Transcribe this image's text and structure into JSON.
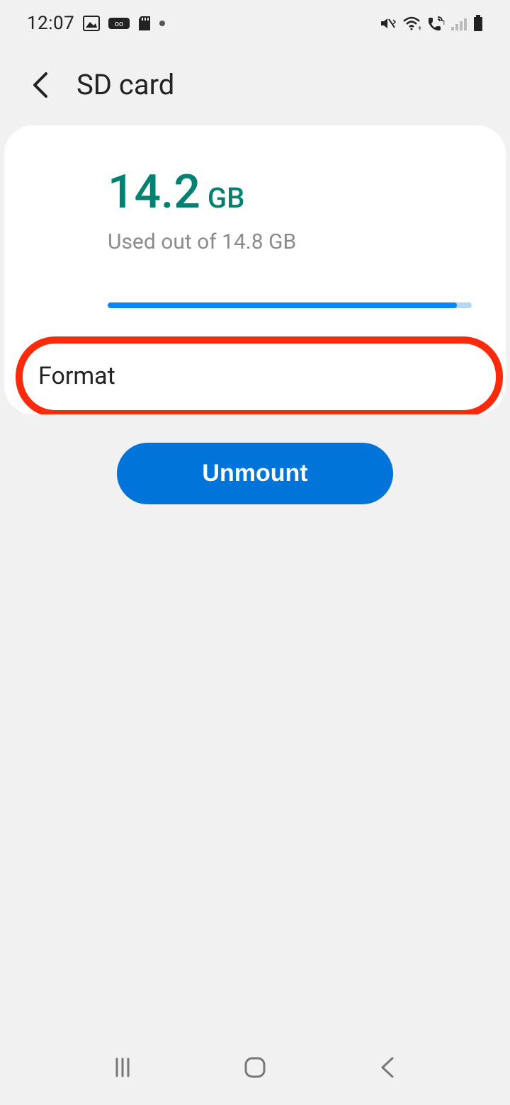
{
  "status_bar": {
    "time": "12:07"
  },
  "header": {
    "title": "SD card"
  },
  "storage": {
    "used_value": "14.2",
    "used_unit": "GB",
    "used_label": "Used out of 14.8 GB",
    "percent_fill": 95.9
  },
  "actions": {
    "format_label": "Format",
    "unmount_label": "Unmount"
  }
}
